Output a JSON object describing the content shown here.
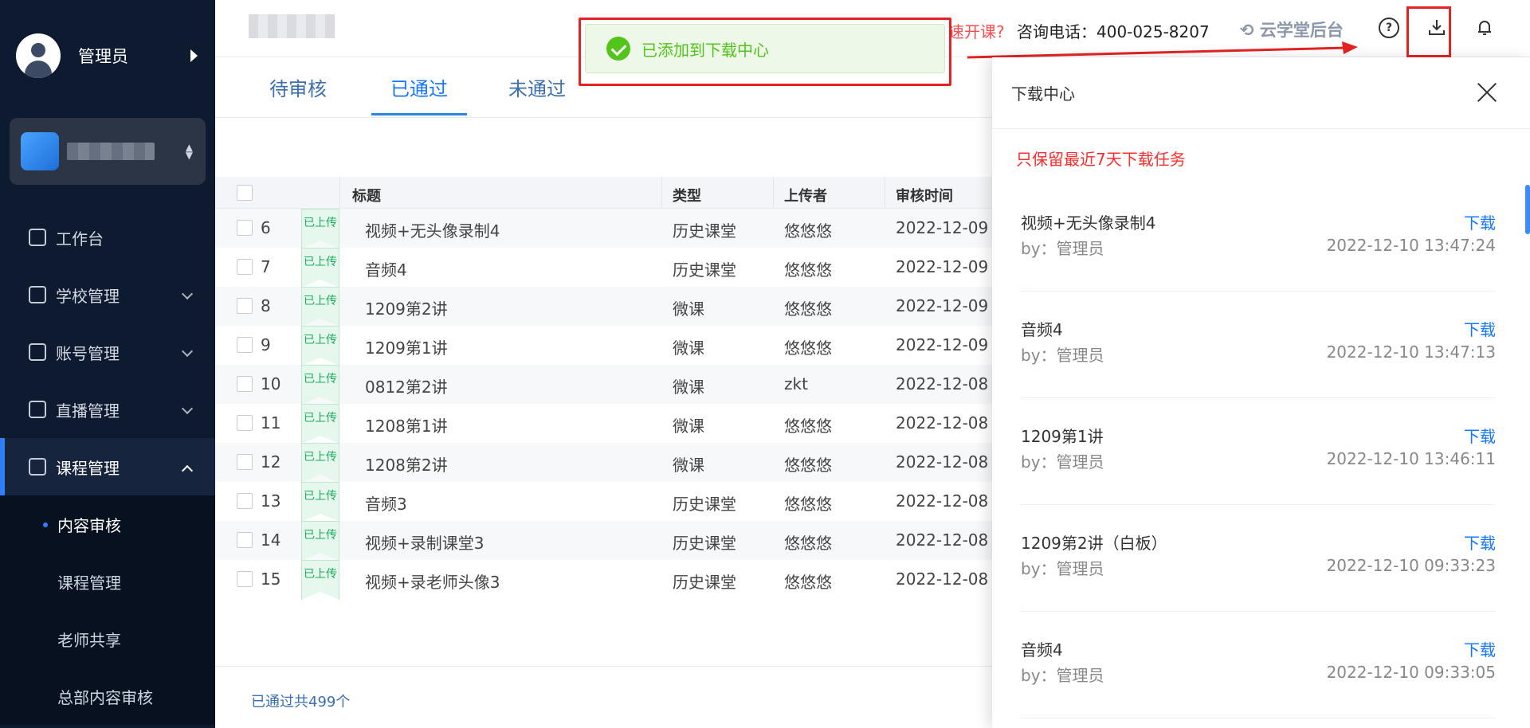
{
  "sidebar": {
    "user_name": "管理员",
    "nav": [
      {
        "label": "工作台"
      },
      {
        "label": "学校管理"
      },
      {
        "label": "账号管理"
      },
      {
        "label": "直播管理"
      },
      {
        "label": "课程管理"
      }
    ],
    "sub": [
      {
        "label": "内容审核"
      },
      {
        "label": "课程管理"
      },
      {
        "label": "老师共享"
      },
      {
        "label": "总部内容审核"
      }
    ]
  },
  "header": {
    "quick_link": "速开课?",
    "phone": "咨询电话：400-025-8207",
    "brand": "云学堂后台"
  },
  "tabs": [
    "待审核",
    "已通过",
    "未通过"
  ],
  "table": {
    "headers": [
      "标题",
      "类型",
      "上传者",
      "审核时间"
    ],
    "badge": "已上传",
    "rows": [
      {
        "num": "6",
        "title": "视频+无头像录制4",
        "type": "历史课堂",
        "uploader": "悠悠悠",
        "date": "2022-12-09"
      },
      {
        "num": "7",
        "title": "音频4",
        "type": "历史课堂",
        "uploader": "悠悠悠",
        "date": "2022-12-09"
      },
      {
        "num": "8",
        "title": "1209第2讲",
        "type": "微课",
        "uploader": "悠悠悠",
        "date": "2022-12-09"
      },
      {
        "num": "9",
        "title": "1209第1讲",
        "type": "微课",
        "uploader": "悠悠悠",
        "date": "2022-12-09"
      },
      {
        "num": "10",
        "title": "0812第2讲",
        "type": "微课",
        "uploader": "zkt",
        "date": "2022-12-08"
      },
      {
        "num": "11",
        "title": "1208第1讲",
        "type": "微课",
        "uploader": "悠悠悠",
        "date": "2022-12-08"
      },
      {
        "num": "12",
        "title": "1208第2讲",
        "type": "微课",
        "uploader": "悠悠悠",
        "date": "2022-12-08"
      },
      {
        "num": "13",
        "title": "音频3",
        "type": "历史课堂",
        "uploader": "悠悠悠",
        "date": "2022-12-08"
      },
      {
        "num": "14",
        "title": "视频+录制课堂3",
        "type": "历史课堂",
        "uploader": "悠悠悠",
        "date": "2022-12-08"
      },
      {
        "num": "15",
        "title": "视频+录老师头像3",
        "type": "历史课堂",
        "uploader": "悠悠悠",
        "date": "2022-12-08"
      }
    ],
    "footer": "已通过共499个"
  },
  "toast": {
    "message": "已添加到下载中心"
  },
  "drawer": {
    "title": "下载中心",
    "notice": "只保留最近7天下载任务",
    "download_label": "下载",
    "items": [
      {
        "title": "视频+无头像录制4",
        "by": "by：管理员",
        "time": "2022-12-10 13:47:24"
      },
      {
        "title": "音频4",
        "by": "by：管理员",
        "time": "2022-12-10 13:47:13"
      },
      {
        "title": "1209第1讲",
        "by": "by：管理员",
        "time": "2022-12-10 13:46:11"
      },
      {
        "title": "1209第2讲（白板）",
        "by": "by：管理员",
        "time": "2022-12-10 09:33:23"
      },
      {
        "title": "音频4",
        "by": "by：管理员",
        "time": "2022-12-10 09:33:05"
      }
    ]
  },
  "colors": {
    "accent": "#1677ff",
    "sidebar": "#0e1a2f",
    "success": "#52c41a",
    "annotation": "#e52222"
  }
}
